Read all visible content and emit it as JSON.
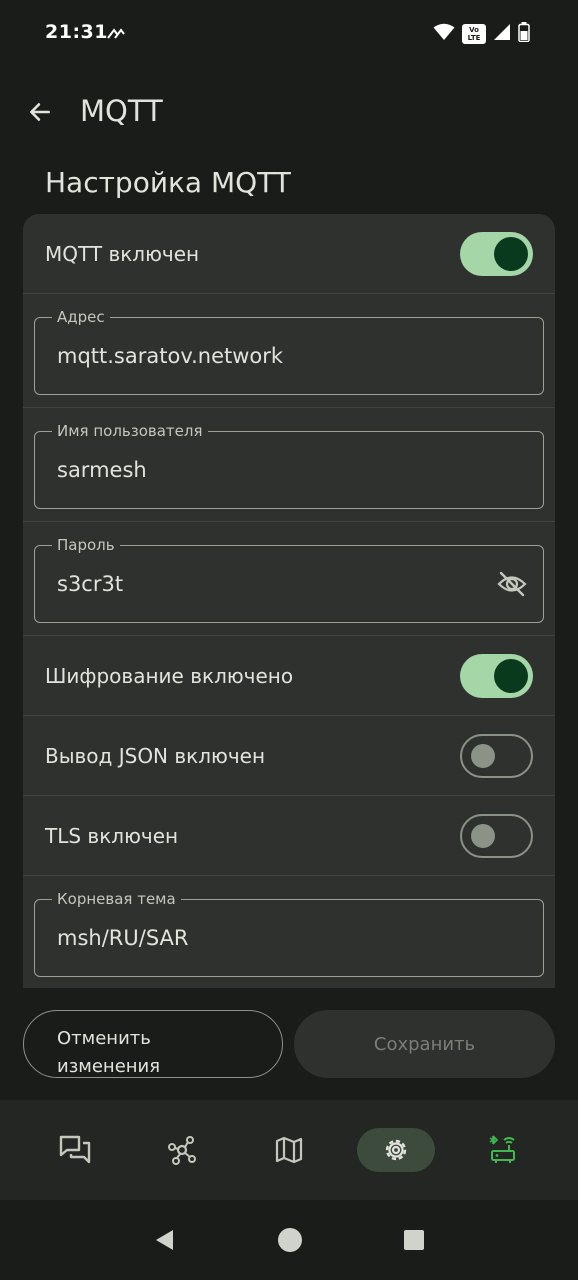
{
  "status_bar": {
    "time": "21:31",
    "volte_top": "Vo",
    "volte_bottom": "LTE"
  },
  "app_bar": {
    "title": "MQTT"
  },
  "section": {
    "title": "Настройка MQTT"
  },
  "settings": {
    "mqtt_enabled": {
      "label": "MQTT включен",
      "value": true
    },
    "address": {
      "label": "Адрес",
      "value": "mqtt.saratov.network"
    },
    "username": {
      "label": "Имя пользователя",
      "value": "sarmesh"
    },
    "password": {
      "label": "Пароль",
      "value": "s3cr3t"
    },
    "encryption_enabled": {
      "label": "Шифрование включено",
      "value": true
    },
    "json_output_enabled": {
      "label": "Вывод JSON включен",
      "value": false
    },
    "tls_enabled": {
      "label": "TLS включен",
      "value": false
    },
    "root_topic": {
      "label": "Корневая тема",
      "value": "msh/RU/SAR"
    }
  },
  "buttons": {
    "cancel_label": "Отменить изменения",
    "save_label": "Сохранить"
  },
  "bottom_nav": {
    "active": "settings",
    "items": [
      "messages-icon",
      "nodes-icon",
      "map-icon",
      "settings-icon",
      "connection-icon"
    ]
  },
  "colors": {
    "accent": "#a5d6a7",
    "connected": "#3fb950"
  }
}
